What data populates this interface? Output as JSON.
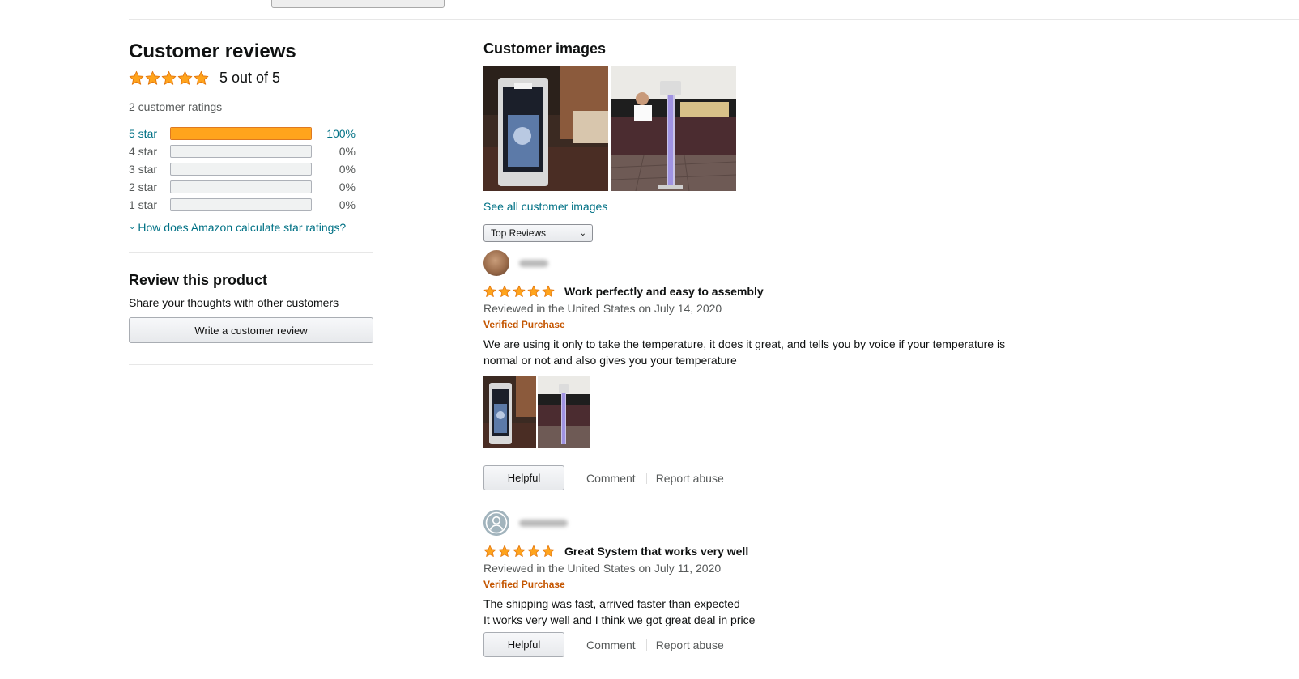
{
  "summary": {
    "heading": "Customer reviews",
    "overall_text": "5 out of 5",
    "total_ratings": "2 customer ratings",
    "histogram": [
      {
        "label": "5 star",
        "pct": "100%",
        "fill": 1.0
      },
      {
        "label": "4 star",
        "pct": "0%",
        "fill": 0
      },
      {
        "label": "3 star",
        "pct": "0%",
        "fill": 0
      },
      {
        "label": "2 star",
        "pct": "0%",
        "fill": 0
      },
      {
        "label": "1 star",
        "pct": "0%",
        "fill": 0
      }
    ],
    "how_calculated_link": "How does Amazon calculate star ratings?"
  },
  "review_this": {
    "heading": "Review this product",
    "subtext": "Share your thoughts with other customers",
    "button": "Write a customer review"
  },
  "images": {
    "heading": "Customer images",
    "see_all": "See all customer images"
  },
  "sort": {
    "selected": "Top Reviews"
  },
  "reviews": [
    {
      "title": "Work perfectly and easy to assembly",
      "date": "Reviewed in the United States on July 14, 2020",
      "verified": "Verified Purchase",
      "body": "We are using it only to take the temperature, it does it great, and tells you by voice if your temperature is normal or not and also gives you your temperature",
      "helpful": "Helpful",
      "comment": "Comment",
      "report": "Report abuse"
    },
    {
      "title": "Great System that works very well",
      "date": "Reviewed in the United States on July 11, 2020",
      "verified": "Verified Purchase",
      "body_line1": "The shipping was fast, arrived faster than expected",
      "body_line2": "It works very well and I think we got great deal in price",
      "helpful": "Helpful",
      "comment": "Comment",
      "report": "Report abuse"
    }
  ],
  "colors": {
    "star": "#ffa41c",
    "link": "#007185",
    "verified": "#c45500",
    "bar_fill": "#ffa41c"
  }
}
